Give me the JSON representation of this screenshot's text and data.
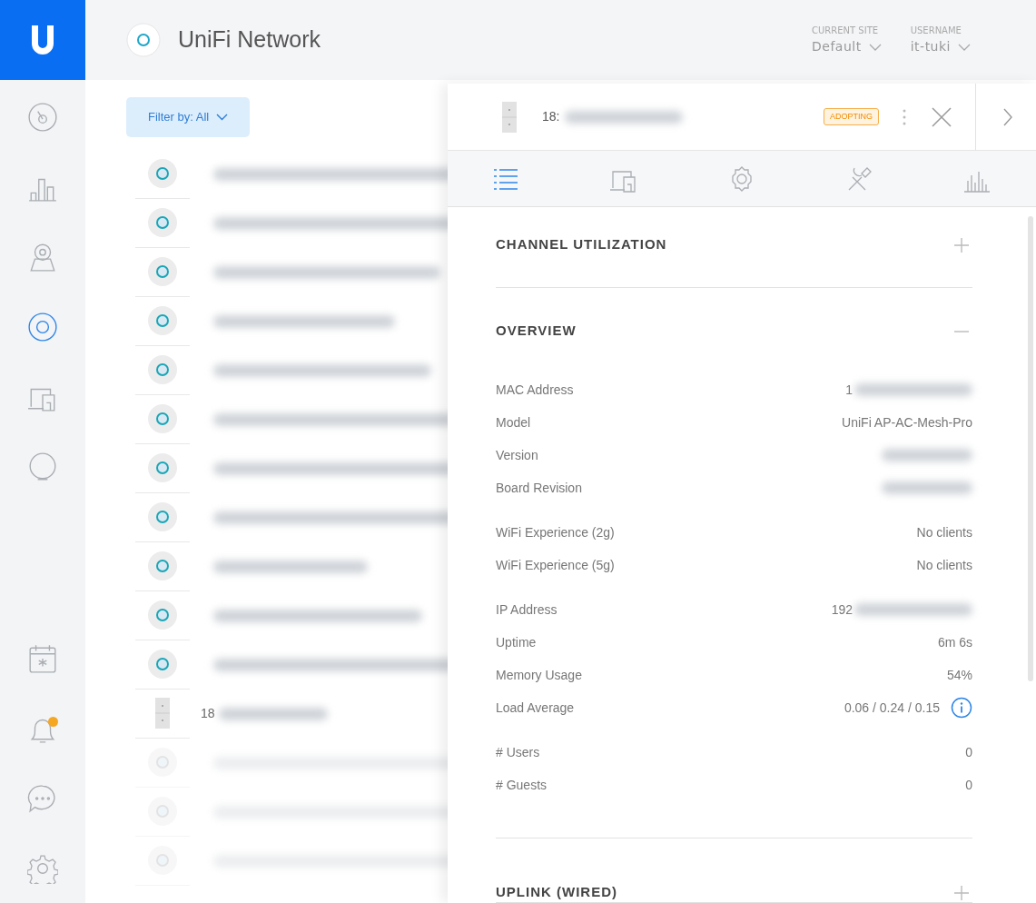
{
  "header": {
    "product": "UniFi Network",
    "site": {
      "label": "CURRENT SITE",
      "value": "Default"
    },
    "user": {
      "label": "USERNAME",
      "value": "it-tuki"
    }
  },
  "sidebar": {
    "items": [
      {
        "selected": false,
        "alert": false
      },
      {
        "selected": false,
        "alert": false
      },
      {
        "selected": false,
        "alert": false
      },
      {
        "selected": true,
        "alert": false
      },
      {
        "selected": false,
        "alert": false
      },
      {
        "selected": false,
        "alert": false
      }
    ],
    "bottom_items": [
      {
        "selected": false,
        "alert": false
      },
      {
        "selected": false,
        "alert": true
      },
      {
        "selected": false,
        "alert": false
      },
      {
        "selected": false,
        "alert": false
      }
    ]
  },
  "filter": {
    "label": "Filter by: All"
  },
  "devices": [
    {
      "kind": "ap",
      "offline": false
    },
    {
      "kind": "ap",
      "offline": false
    },
    {
      "kind": "ap",
      "offline": false
    },
    {
      "kind": "ap",
      "offline": false
    },
    {
      "kind": "ap",
      "offline": false
    },
    {
      "kind": "ap",
      "offline": false
    },
    {
      "kind": "ap",
      "offline": false
    },
    {
      "kind": "ap",
      "offline": false
    },
    {
      "kind": "ap",
      "offline": false
    },
    {
      "kind": "ap",
      "offline": false
    },
    {
      "kind": "ap",
      "offline": false
    },
    {
      "kind": "mesh",
      "offline": false,
      "name": "18"
    },
    {
      "kind": "ap",
      "offline": true
    },
    {
      "kind": "ap",
      "offline": true
    },
    {
      "kind": "ap",
      "offline": true
    }
  ],
  "panel": {
    "device": {
      "name": "18:",
      "status": "ADOPTING"
    },
    "tabs": [
      {
        "selected": true
      },
      {
        "selected": false
      },
      {
        "selected": false
      },
      {
        "selected": false
      },
      {
        "selected": false
      }
    ],
    "sections": [
      {
        "title": "CHANNEL UTILIZATION",
        "expanded": false
      },
      {
        "title": "OVERVIEW",
        "expanded": true,
        "groups": [
          [
            {
              "label": "MAC Address",
              "value": "1",
              "blurred": true
            },
            {
              "label": "Model",
              "value": "UniFi AP-AC-Mesh-Pro",
              "blurred": false
            },
            {
              "label": "Version",
              "blurred": true
            },
            {
              "label": "Board Revision",
              "blurred": true
            }
          ],
          [
            {
              "label": "WiFi Experience (2g)",
              "value": "No clients",
              "blurred": false
            },
            {
              "label": "WiFi Experience (5g)",
              "value": "No clients",
              "blurred": false
            }
          ],
          [
            {
              "label": "IP Address",
              "value": "192",
              "blurred": true
            },
            {
              "label": "Uptime",
              "value": "6m 6s",
              "blurred": false
            },
            {
              "label": "Memory Usage",
              "value": "54%",
              "blurred": false
            },
            {
              "label": "Load Average",
              "value": "0.06 / 0.24 / 0.15",
              "blurred": false,
              "info": true
            }
          ],
          [
            {
              "label": "# Users",
              "value": "0",
              "blurred": false
            },
            {
              "label": "# Guests",
              "value": "0",
              "blurred": false
            }
          ]
        ]
      },
      {
        "title": "UPLINK (WIRED)",
        "expanded": false
      }
    ]
  }
}
